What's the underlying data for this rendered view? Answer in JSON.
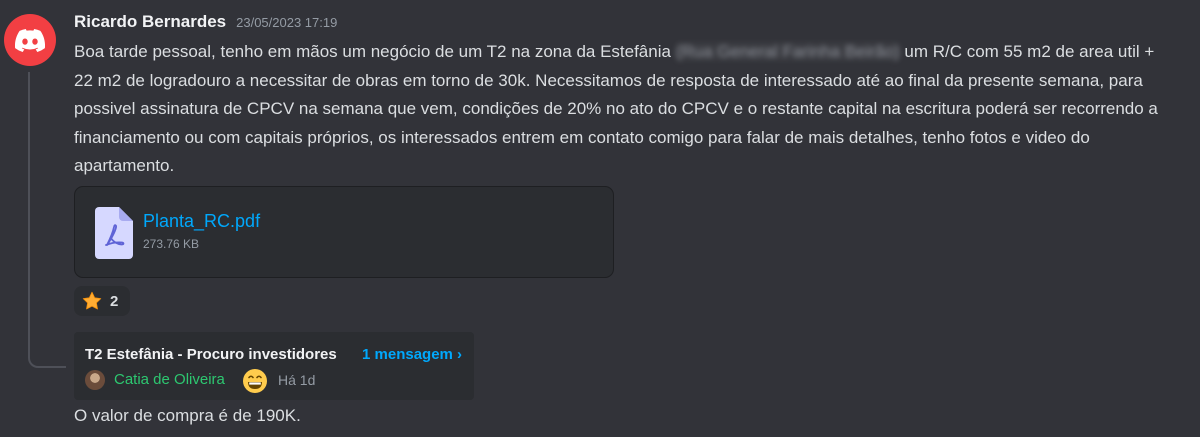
{
  "post": {
    "author": "Ricardo Bernardes",
    "timestamp": "23/05/2023 17:19",
    "text_before_blur": "Boa tarde pessoal, tenho em mãos um  negócio de um T2 na zona da Estefânia ",
    "blurred_text": "(Rua General Farinha Beirão)",
    "text_after_blur": " um R/C com 55 m2 de area util + 22 m2 de logradouro a necessitar de obras em torno de 30k. Necessitamos de resposta de interessado até ao final da presente semana, para possivel assinatura de CPCV na semana que vem, condições de 20% no ato do CPCV e o restante capital na escritura poderá ser recorrendo a financiamento ou com capitais próprios, os interessados entrem em contato comigo para falar de mais detalhes, tenho fotos e video do apartamento."
  },
  "attachment": {
    "file_name": "Planta_RC.pdf",
    "file_size": "273.76 KB",
    "icon": "pdf-file-icon"
  },
  "reaction": {
    "emoji": "star-icon",
    "count": "2"
  },
  "thread": {
    "title": "T2 Estefânia - Procuro investidores",
    "message_count": "1 mensagem ›",
    "last_user": "Catia de Oliveira",
    "last_user_emoji": "grinning-face-icon",
    "last_activity": "Há 1d"
  },
  "reply": {
    "text": "O valor de compra é de 190K."
  },
  "colors": {
    "background": "#323339",
    "avatar_red": "#f23f43",
    "link_blue": "#00a8fc",
    "username_green": "#2dc770"
  }
}
